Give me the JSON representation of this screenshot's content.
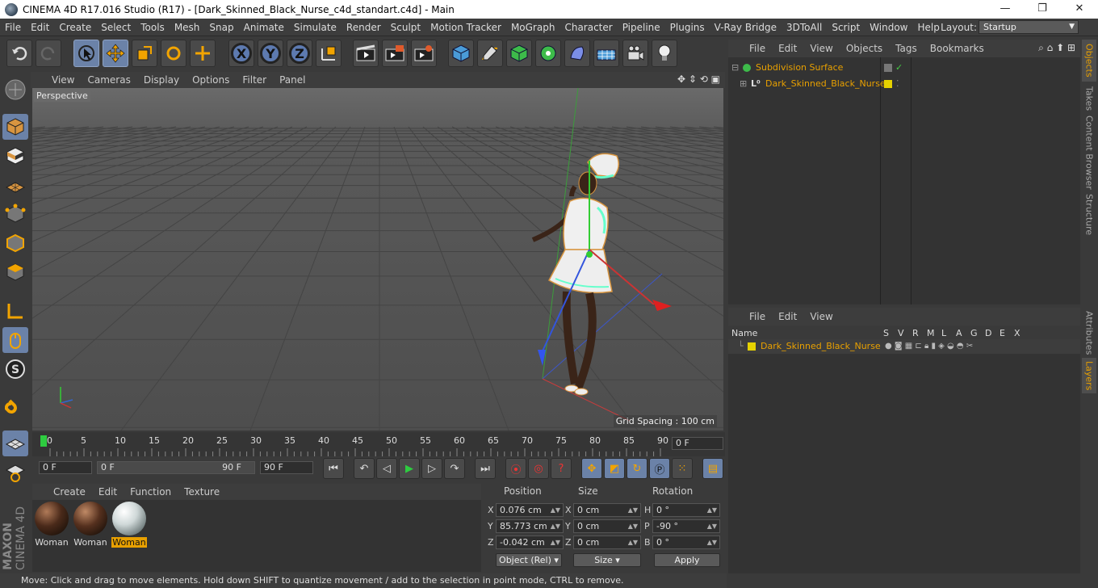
{
  "window": {
    "title": "CINEMA 4D R17.016 Studio (R17) - [Dark_Skinned_Black_Nurse_c4d_standart.c4d] - Main",
    "controls": [
      "—",
      "❐",
      "✕"
    ]
  },
  "menu": [
    "File",
    "Edit",
    "Create",
    "Select",
    "Tools",
    "Mesh",
    "Snap",
    "Animate",
    "Simulate",
    "Render",
    "Sculpt",
    "Motion Tracker",
    "MoGraph",
    "Character",
    "Pipeline",
    "Plugins",
    "V-Ray Bridge",
    "3DToAll",
    "Script",
    "Window",
    "Help"
  ],
  "layout": {
    "label": "Layout:",
    "value": "Startup"
  },
  "viewport": {
    "menu": [
      "View",
      "Cameras",
      "Display",
      "Options",
      "Filter",
      "Panel"
    ],
    "label": "Perspective",
    "grid_spacing": "Grid Spacing : 100 cm"
  },
  "timeline": {
    "ticks": [
      "0",
      "5",
      "10",
      "15",
      "20",
      "25",
      "30",
      "35",
      "40",
      "45",
      "50",
      "55",
      "60",
      "65",
      "70",
      "75",
      "80",
      "85",
      "90"
    ],
    "current_frame": "0 F"
  },
  "transport": {
    "start": "0 F",
    "range_start": "0 F",
    "range_end": "90 F",
    "end": "90 F"
  },
  "materials": {
    "menu": [
      "Create",
      "Edit",
      "Function",
      "Texture"
    ],
    "items": [
      {
        "name": "Woman",
        "selected": false
      },
      {
        "name": "Woman",
        "selected": false
      },
      {
        "name": "Woman",
        "selected": true
      }
    ]
  },
  "coordinates": {
    "headers": {
      "position": "Position",
      "size": "Size",
      "rotation": "Rotation"
    },
    "rows": [
      {
        "pl": "X",
        "pv": "0.076 cm",
        "sl": "X",
        "sv": "0 cm",
        "rl": "H",
        "rv": "0 °"
      },
      {
        "pl": "Y",
        "pv": "85.773 cm",
        "sl": "Y",
        "sv": "0 cm",
        "rl": "P",
        "rv": "-90 °"
      },
      {
        "pl": "Z",
        "pv": "-0.042 cm",
        "sl": "Z",
        "sv": "0 cm",
        "rl": "B",
        "rv": "0 °"
      }
    ],
    "mode": "Object (Rel)",
    "size_mode": "Size",
    "apply": "Apply"
  },
  "brand": {
    "maxon": "MAXON",
    "product": "CINEMA 4D"
  },
  "status": "Move: Click and drag to move elements. Hold down SHIFT to quantize movement / add to the selection in point mode, CTRL to remove.",
  "objects": {
    "menu": [
      "File",
      "Edit",
      "View",
      "Objects",
      "Tags",
      "Bookmarks"
    ],
    "items": [
      {
        "name": "Subdivision Surface"
      },
      {
        "name": "Dark_Skinned_Black_Nurse"
      }
    ]
  },
  "layers": {
    "menu": [
      "File",
      "Edit",
      "View"
    ],
    "columns": {
      "name": "Name",
      "flags": [
        "S",
        "V",
        "R",
        "M",
        "L",
        "A",
        "G",
        "D",
        "E",
        "X"
      ]
    },
    "items": [
      {
        "name": "Dark_Skinned_Black_Nurse"
      }
    ]
  },
  "right_tabs": [
    "Objects",
    "Takes",
    "Content Browser",
    "Structure",
    "Attributes",
    "Layers"
  ],
  "colors": {
    "accent": "#e8a000",
    "selection": "#6b82a8",
    "layer_yellow": "#e6d200"
  }
}
